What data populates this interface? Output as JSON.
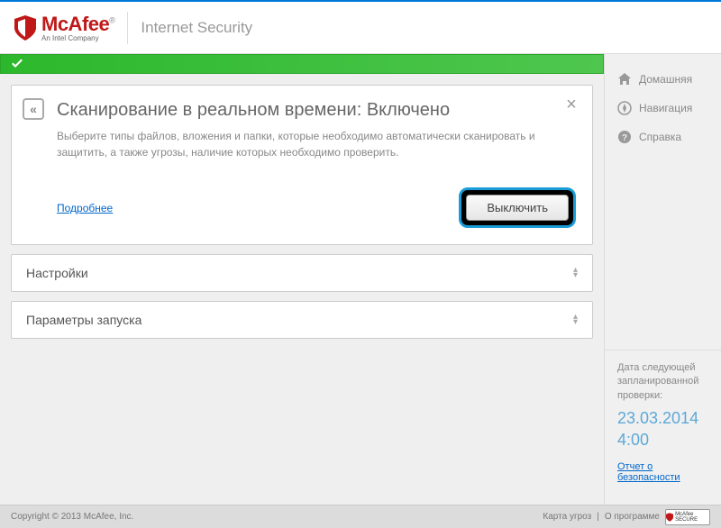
{
  "header": {
    "brand": "McAfee",
    "tagline": "An Intel Company",
    "product": "Internet Security"
  },
  "panel": {
    "title": "Сканирование в реальном времени: Включено",
    "description": "Выберите типы файлов, вложения и папки, которые необходимо автоматически сканировать и защитить, а также угрозы, наличие которых необходимо проверить.",
    "more_link": "Подробнее",
    "disable_button": "Выключить"
  },
  "accordions": [
    {
      "label": "Настройки"
    },
    {
      "label": "Параметры запуска"
    }
  ],
  "sidebar": {
    "items": [
      {
        "label": "Домашняя"
      },
      {
        "label": "Навигация"
      },
      {
        "label": "Справка"
      }
    ],
    "scan_label": "Дата следующей запланированной проверки:",
    "scan_date": "23.03.2014 4:00",
    "report_link": "Отчет о безопасности"
  },
  "footer": {
    "copyright": "Copyright © 2013 McAfee, Inc.",
    "threat_map": "Карта угроз",
    "about": "О программе",
    "secure": "McAfee SECURE"
  }
}
